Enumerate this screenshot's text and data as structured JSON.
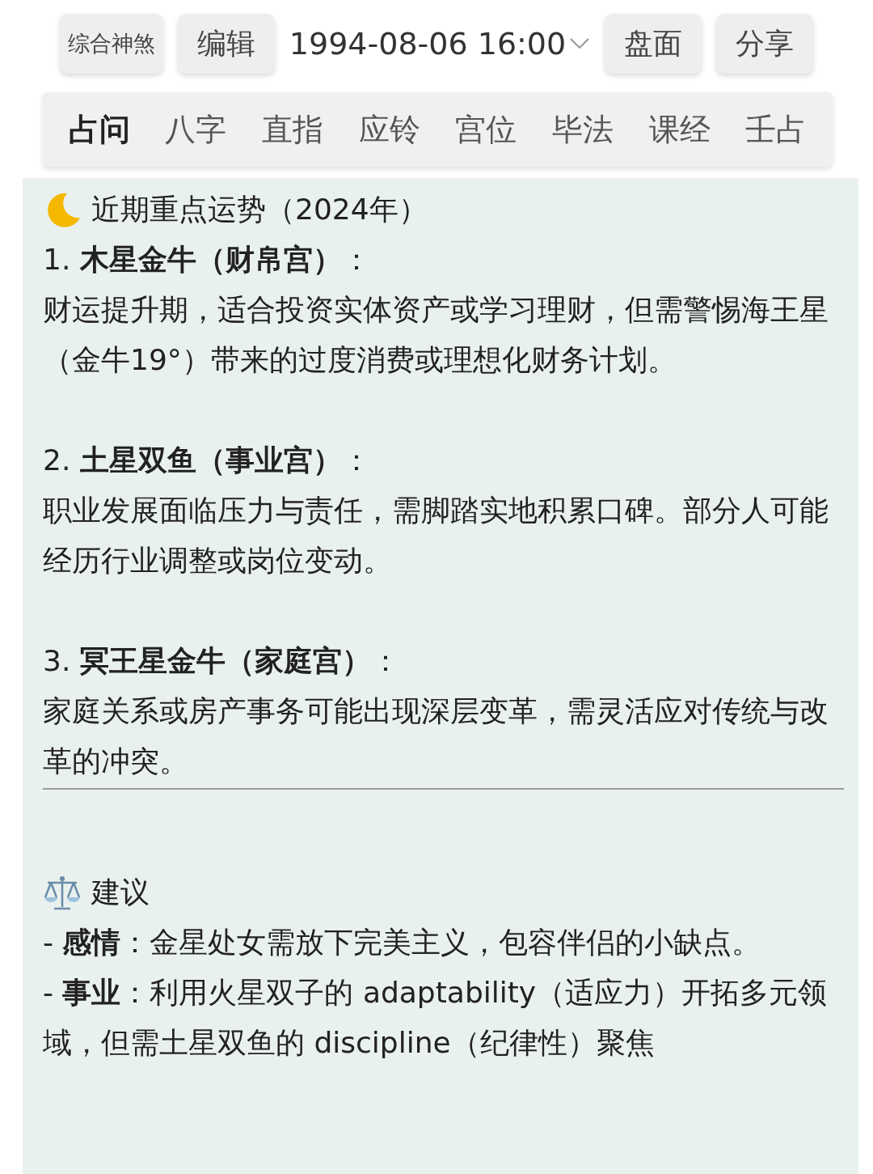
{
  "toolbar": {
    "buttons": [
      {
        "label": "综合神煞",
        "kind": "small"
      },
      {
        "label": "编辑",
        "kind": "normal"
      }
    ],
    "date": "1994-08-06 16:00",
    "buttons_right": [
      {
        "label": "盘面",
        "kind": "normal"
      },
      {
        "label": "分享",
        "kind": "normal"
      }
    ]
  },
  "tabs": [
    {
      "label": "占问",
      "selected": true
    },
    {
      "label": "八字",
      "selected": false
    },
    {
      "label": "直指",
      "selected": false
    },
    {
      "label": "应铃",
      "selected": false
    },
    {
      "label": "宫位",
      "selected": false
    },
    {
      "label": "毕法",
      "selected": false
    },
    {
      "label": "课经",
      "selected": false
    },
    {
      "label": "壬占",
      "selected": false
    }
  ],
  "content": [
    {
      "kind": "heading",
      "text": "近期重点运势（2024年）"
    },
    {
      "kind": "text",
      "text": "1. **木星金牛（财帛宫）**："
    },
    {
      "kind": "text",
      "text": "财运提升期，适合投资实体资产或学习理财，但需警惕海王星（金牛19°）带来的过度消费或理想化财务计划。"
    },
    {
      "kind": "gap"
    },
    {
      "kind": "text",
      "text": "2. **土星双鱼（事业宫）**："
    },
    {
      "kind": "text",
      "text": "职业发展面临压力与责任，需脚踏实地积累口碑。部分人可能经历行业调整或岗位变动。"
    },
    {
      "kind": "gap"
    },
    {
      "kind": "text",
      "text": "3. **冥王星金牛（家庭宫）**："
    },
    {
      "kind": "text",
      "text": "家庭关系或房产事务可能出现深层变革，需灵活应对传统与改革的冲突。"
    },
    {
      "kind": "rule"
    },
    {
      "kind": "gap"
    },
    {
      "kind": "heading",
      "text": "建议"
    },
    {
      "kind": "text",
      "text": "- **感情**：金星处女需放下完美主义，包容伴侣的小缺点。"
    },
    {
      "kind": "text",
      "text": "- **事业**：利用火星双子的 adaptability（适应力）开拓多元领域，但需土星双鱼的 discipline（纪律性）聚焦"
    }
  ]
}
